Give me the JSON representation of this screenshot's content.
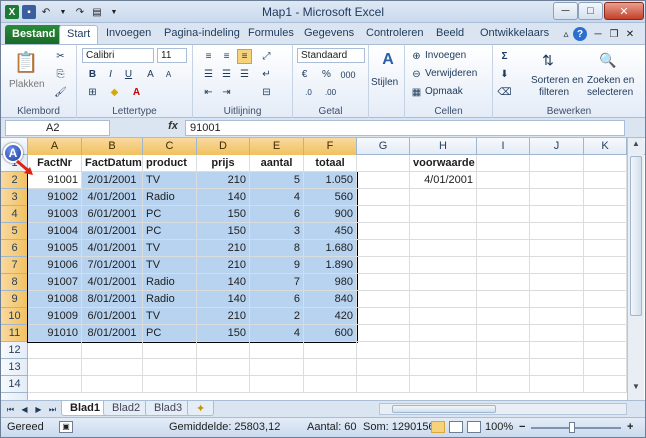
{
  "window": {
    "title": "Map1 - Microsoft Excel",
    "minimize": "─",
    "maximize": "□",
    "close": "✕"
  },
  "qat": {
    "icons": [
      "excel-icon",
      "save-icon",
      "undo-icon",
      "redo-icon",
      "print-preview-icon"
    ]
  },
  "tabs": [
    "Bestand",
    "Start",
    "Invoegen",
    "Pagina-indeling",
    "Formules",
    "Gegevens",
    "Controleren",
    "Beeld",
    "Ontwikkelaars"
  ],
  "ribbon": {
    "clipboard": {
      "paste": "Plakken",
      "label": "Klembord"
    },
    "font": {
      "name": "Calibri",
      "size": "11",
      "label": "Lettertype",
      "bold": "B",
      "italic": "I",
      "underline": "U"
    },
    "alignment": {
      "label": "Uitlijning"
    },
    "number": {
      "format": "Standaard",
      "label": "Getal",
      "percent": "%",
      "thousands": "000"
    },
    "styles": {
      "label": "Stijlen"
    },
    "cells": {
      "insert": "Invoegen",
      "delete": "Verwijderen",
      "format": "Opmaak",
      "label": "Cellen"
    },
    "editing": {
      "sort1": "Sorteren en",
      "sort2": "filteren",
      "find1": "Zoeken en",
      "find2": "selecteren",
      "label": "Bewerken"
    }
  },
  "formula_bar": {
    "name_box": "A2",
    "fx": "fx",
    "value": "91001"
  },
  "columns": [
    "A",
    "B",
    "C",
    "D",
    "E",
    "F",
    "G",
    "H",
    "I",
    "J",
    "K"
  ],
  "rows": [
    "1",
    "2",
    "3",
    "4",
    "5",
    "6",
    "7",
    "8",
    "9",
    "10",
    "11",
    "12",
    "13",
    "14"
  ],
  "table": {
    "headers": [
      "FactNr",
      "FactDatum",
      "product",
      "prijs",
      "aantal",
      "totaal"
    ],
    "rows": [
      [
        "91001",
        "2/01/2001",
        "TV",
        "210",
        "5",
        "1.050"
      ],
      [
        "91002",
        "4/01/2001",
        "Radio",
        "140",
        "4",
        "560"
      ],
      [
        "91003",
        "6/01/2001",
        "PC",
        "150",
        "6",
        "900"
      ],
      [
        "91004",
        "8/01/2001",
        "PC",
        "150",
        "3",
        "450"
      ],
      [
        "91005",
        "4/01/2001",
        "TV",
        "210",
        "8",
        "1.680"
      ],
      [
        "91006",
        "7/01/2001",
        "TV",
        "210",
        "9",
        "1.890"
      ],
      [
        "91007",
        "4/01/2001",
        "Radio",
        "140",
        "7",
        "980"
      ],
      [
        "91008",
        "8/01/2001",
        "Radio",
        "140",
        "6",
        "840"
      ],
      [
        "91009",
        "6/01/2001",
        "TV",
        "210",
        "2",
        "420"
      ],
      [
        "91010",
        "8/01/2001",
        "PC",
        "150",
        "4",
        "600"
      ]
    ]
  },
  "criteria": {
    "header": "voorwaarde",
    "value": "4/01/2001"
  },
  "callout": "A",
  "sheets": [
    "Blad1",
    "Blad2",
    "Blad3"
  ],
  "status": {
    "ready": "Gereed",
    "average": "Gemiddelde: 25803,12",
    "count": "Aantal: 60",
    "sum": "Som: 1290156",
    "zoom": "100%"
  }
}
